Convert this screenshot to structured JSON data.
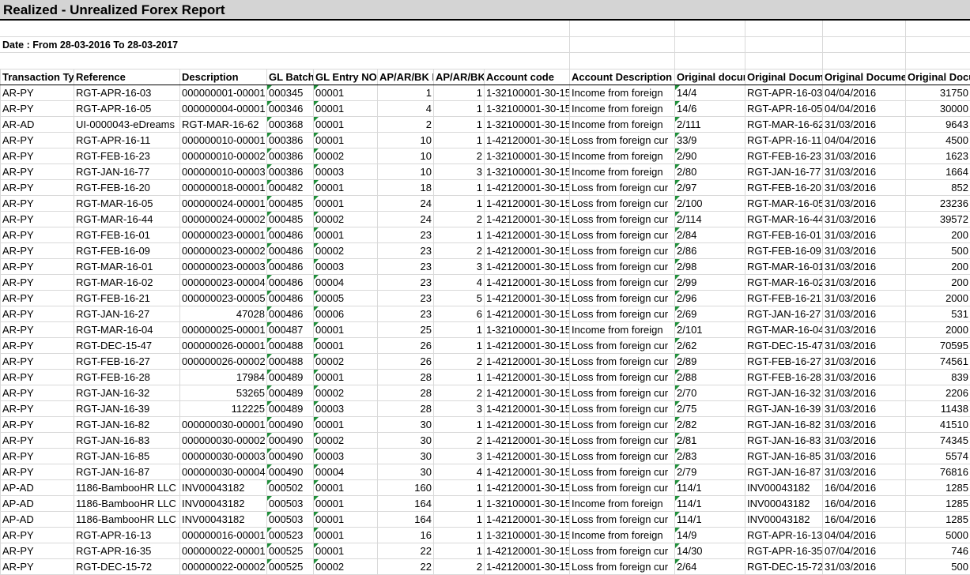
{
  "report": {
    "title": "Realized - Unrealized Forex Report",
    "date_range": "Date : From 28-03-2016 To 28-03-2017"
  },
  "columns": [
    "Transaction Ty",
    "Reference",
    "Description",
    "GL Batch",
    "GL Entry NO",
    "AP/AR/BK I",
    "AP/AR/BK",
    "Account code",
    "Account Description",
    "Original docur",
    "Original Docum",
    "Original Docume",
    "Original Docu"
  ],
  "rows": [
    [
      "AR-PY",
      "RGT-APR-16-03",
      "000000001-00001",
      "000345",
      "00001",
      "1",
      "1",
      "1-32100001-30-15",
      "Income from foreign",
      "14/4",
      "RGT-APR-16-03",
      "04/04/2016",
      "31750"
    ],
    [
      "AR-PY",
      "RGT-APR-16-05",
      "000000004-00001",
      "000346",
      "00001",
      "4",
      "1",
      "1-32100001-30-15",
      "Income from foreign",
      "14/6",
      "RGT-APR-16-05",
      "04/04/2016",
      "30000"
    ],
    [
      "AR-AD",
      "UI-0000043-eDreams",
      "RGT-MAR-16-62",
      "000368",
      "00001",
      "2",
      "1",
      "1-32100001-30-15",
      "Income from foreign",
      "2/111",
      "RGT-MAR-16-62",
      "31/03/2016",
      "9643"
    ],
    [
      "AR-PY",
      "RGT-APR-16-11",
      "000000010-00001",
      "000386",
      "00001",
      "10",
      "1",
      "1-42120001-30-15",
      "Loss from foreign cur",
      "33/9",
      "RGT-APR-16-11",
      "04/04/2016",
      "4500"
    ],
    [
      "AR-PY",
      "RGT-FEB-16-23",
      "000000010-00002",
      "000386",
      "00002",
      "10",
      "2",
      "1-32100001-30-15",
      "Income from foreign",
      "2/90",
      "RGT-FEB-16-23",
      "31/03/2016",
      "1623"
    ],
    [
      "AR-PY",
      "RGT-JAN-16-77",
      "000000010-00003",
      "000386",
      "00003",
      "10",
      "3",
      "1-32100001-30-15",
      "Income from foreign",
      "2/80",
      "RGT-JAN-16-77",
      "31/03/2016",
      "1664"
    ],
    [
      "AR-PY",
      "RGT-FEB-16-20",
      "000000018-00001",
      "000482",
      "00001",
      "18",
      "1",
      "1-42120001-30-15",
      "Loss from foreign cur",
      "2/97",
      "RGT-FEB-16-20",
      "31/03/2016",
      "852"
    ],
    [
      "AR-PY",
      "RGT-MAR-16-05",
      "000000024-00001",
      "000485",
      "00001",
      "24",
      "1",
      "1-42120001-30-15",
      "Loss from foreign cur",
      "2/100",
      "RGT-MAR-16-05",
      "31/03/2016",
      "23236"
    ],
    [
      "AR-PY",
      "RGT-MAR-16-44",
      "000000024-00002",
      "000485",
      "00002",
      "24",
      "2",
      "1-42120001-30-15",
      "Loss from foreign cur",
      "2/114",
      "RGT-MAR-16-44",
      "31/03/2016",
      "39572"
    ],
    [
      "AR-PY",
      "RGT-FEB-16-01",
      "000000023-00001",
      "000486",
      "00001",
      "23",
      "1",
      "1-42120001-30-15",
      "Loss from foreign cur",
      "2/84",
      "RGT-FEB-16-01",
      "31/03/2016",
      "200"
    ],
    [
      "AR-PY",
      "RGT-FEB-16-09",
      "000000023-00002",
      "000486",
      "00002",
      "23",
      "2",
      "1-42120001-30-15",
      "Loss from foreign cur",
      "2/86",
      "RGT-FEB-16-09",
      "31/03/2016",
      "500"
    ],
    [
      "AR-PY",
      "RGT-MAR-16-01",
      "000000023-00003",
      "000486",
      "00003",
      "23",
      "3",
      "1-42120001-30-15",
      "Loss from foreign cur",
      "2/98",
      "RGT-MAR-16-01",
      "31/03/2016",
      "200"
    ],
    [
      "AR-PY",
      "RGT-MAR-16-02",
      "000000023-00004",
      "000486",
      "00004",
      "23",
      "4",
      "1-42120001-30-15",
      "Loss from foreign cur",
      "2/99",
      "RGT-MAR-16-02",
      "31/03/2016",
      "200"
    ],
    [
      "AR-PY",
      "RGT-FEB-16-21",
      "000000023-00005",
      "000486",
      "00005",
      "23",
      "5",
      "1-42120001-30-15",
      "Loss from foreign cur",
      "2/96",
      "RGT-FEB-16-21",
      "31/03/2016",
      "2000"
    ],
    [
      "AR-PY",
      "RGT-JAN-16-27",
      "47028",
      "000486",
      "00006",
      "23",
      "6",
      "1-42120001-30-15",
      "Loss from foreign cur",
      "2/69",
      "RGT-JAN-16-27",
      "31/03/2016",
      "531"
    ],
    [
      "AR-PY",
      "RGT-MAR-16-04",
      "000000025-00001",
      "000487",
      "00001",
      "25",
      "1",
      "1-32100001-30-15",
      "Income from foreign",
      "2/101",
      "RGT-MAR-16-04",
      "31/03/2016",
      "2000"
    ],
    [
      "AR-PY",
      "RGT-DEC-15-47",
      "000000026-00001",
      "000488",
      "00001",
      "26",
      "1",
      "1-42120001-30-15",
      "Loss from foreign cur",
      "2/62",
      "RGT-DEC-15-47",
      "31/03/2016",
      "70595"
    ],
    [
      "AR-PY",
      "RGT-FEB-16-27",
      "000000026-00002",
      "000488",
      "00002",
      "26",
      "2",
      "1-42120001-30-15",
      "Loss from foreign cur",
      "2/89",
      "RGT-FEB-16-27",
      "31/03/2016",
      "74561"
    ],
    [
      "AR-PY",
      "RGT-FEB-16-28",
      "17984",
      "000489",
      "00001",
      "28",
      "1",
      "1-42120001-30-15",
      "Loss from foreign cur",
      "2/88",
      "RGT-FEB-16-28",
      "31/03/2016",
      "839"
    ],
    [
      "AR-PY",
      "RGT-JAN-16-32",
      "53265",
      "000489",
      "00002",
      "28",
      "2",
      "1-42120001-30-15",
      "Loss from foreign cur",
      "2/70",
      "RGT-JAN-16-32",
      "31/03/2016",
      "2206"
    ],
    [
      "AR-PY",
      "RGT-JAN-16-39",
      "112225",
      "000489",
      "00003",
      "28",
      "3",
      "1-42120001-30-15",
      "Loss from foreign cur",
      "2/75",
      "RGT-JAN-16-39",
      "31/03/2016",
      "11438"
    ],
    [
      "AR-PY",
      "RGT-JAN-16-82",
      "000000030-00001",
      "000490",
      "00001",
      "30",
      "1",
      "1-42120001-30-15",
      "Loss from foreign cur",
      "2/82",
      "RGT-JAN-16-82",
      "31/03/2016",
      "41510"
    ],
    [
      "AR-PY",
      "RGT-JAN-16-83",
      "000000030-00002",
      "000490",
      "00002",
      "30",
      "2",
      "1-42120001-30-15",
      "Loss from foreign cur",
      "2/81",
      "RGT-JAN-16-83",
      "31/03/2016",
      "74345"
    ],
    [
      "AR-PY",
      "RGT-JAN-16-85",
      "000000030-00003",
      "000490",
      "00003",
      "30",
      "3",
      "1-42120001-30-15",
      "Loss from foreign cur",
      "2/83",
      "RGT-JAN-16-85",
      "31/03/2016",
      "5574"
    ],
    [
      "AR-PY",
      "RGT-JAN-16-87",
      "000000030-00004",
      "000490",
      "00004",
      "30",
      "4",
      "1-42120001-30-15",
      "Loss from foreign cur",
      "2/79",
      "RGT-JAN-16-87",
      "31/03/2016",
      "76816"
    ],
    [
      "AP-AD",
      "1186-BambooHR LLC",
      "INV00043182",
      "000502",
      "00001",
      "160",
      "1",
      "1-42120001-30-15",
      "Loss from foreign cur",
      "114/1",
      "INV00043182",
      "16/04/2016",
      "1285"
    ],
    [
      "AP-AD",
      "1186-BambooHR LLC",
      "INV00043182",
      "000503",
      "00001",
      "164",
      "1",
      "1-32100001-30-15",
      "Income from foreign",
      "114/1",
      "INV00043182",
      "16/04/2016",
      "1285"
    ],
    [
      "AP-AD",
      "1186-BambooHR LLC",
      "INV00043182",
      "000503",
      "00001",
      "164",
      "1",
      "1-42120001-30-15",
      "Loss from foreign cur",
      "114/1",
      "INV00043182",
      "16/04/2016",
      "1285"
    ],
    [
      "AR-PY",
      "RGT-APR-16-13",
      "000000016-00001",
      "000523",
      "00001",
      "16",
      "1",
      "1-32100001-30-15",
      "Income from foreign",
      "14/9",
      "RGT-APR-16-13",
      "04/04/2016",
      "5000"
    ],
    [
      "AR-PY",
      "RGT-APR-16-35",
      "000000022-00001",
      "000525",
      "00001",
      "22",
      "1",
      "1-42120001-30-15",
      "Loss from foreign cur",
      "14/30",
      "RGT-APR-16-35",
      "07/04/2016",
      "746"
    ],
    [
      "AR-PY",
      "RGT-DEC-15-72",
      "000000022-00002",
      "000525",
      "00002",
      "22",
      "2",
      "1-42120001-30-15",
      "Loss from foreign cur",
      "2/64",
      "RGT-DEC-15-72",
      "31/03/2016",
      "500"
    ]
  ]
}
